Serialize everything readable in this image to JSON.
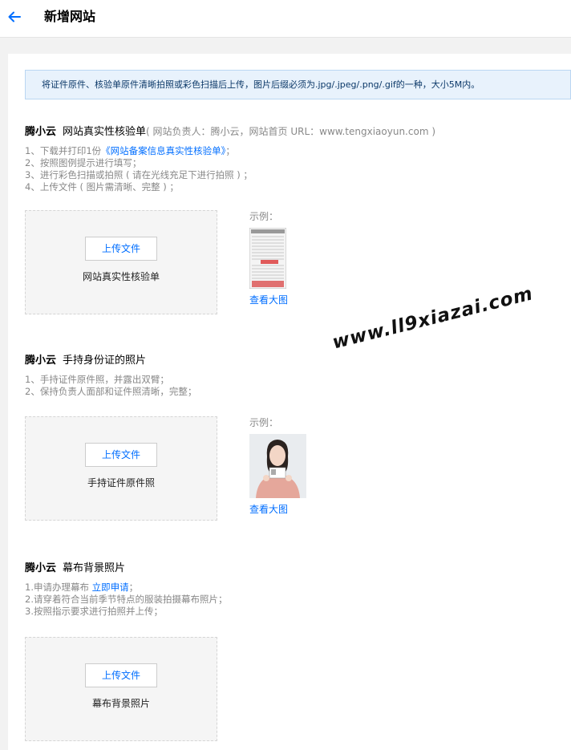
{
  "header": {
    "title": "新增网站",
    "back_icon": "arrow-left-icon"
  },
  "notice": "将证件原件、核验单原件清晰拍照或彩色扫描后上传，图片后缀必须为.jpg/.jpeg/.png/.gif的一种，大小5M内。",
  "sections": [
    {
      "brand": "腾小云",
      "name": "网站真实性核验单",
      "meta": "( 网站负责人：腾小云，网站首页 URL：www.tengxiaoyun.com )",
      "steps": [
        {
          "prefix": "1、下载并打印1份",
          "link": "《网站备案信息真实性核验单》",
          "suffix": "；"
        },
        {
          "prefix": "2、按照图例提示进行填写；"
        },
        {
          "prefix": "3、进行彩色扫描或拍照 ( 请在光线充足下进行拍照 ) ；"
        },
        {
          "prefix": "4、上传文件 ( 图片需清晰、完整 ) ；"
        }
      ],
      "upload_button": "上传文件",
      "upload_label": "网站真实性核验单",
      "example_label": "示例：",
      "view_large": "查看大图"
    },
    {
      "brand": "腾小云",
      "name": "手持身份证的照片",
      "steps": [
        {
          "prefix": "1、手持证件原件照，并露出双臂；"
        },
        {
          "prefix": "2、保持负责人面部和证件照清晰，完整；"
        }
      ],
      "upload_button": "上传文件",
      "upload_label": "手持证件原件照",
      "example_label": "示例：",
      "view_large": "查看大图"
    },
    {
      "brand": "腾小云",
      "name": "幕布背景照片",
      "steps": [
        {
          "prefix": "1.申请办理幕布 ",
          "link": "立即申请",
          "suffix": "；"
        },
        {
          "prefix": "2.请穿着符合当前季节特点的服装拍摄幕布照片；"
        },
        {
          "prefix": "3.按照指示要求进行拍照并上传；"
        }
      ],
      "upload_button": "上传文件",
      "upload_label": "幕布背景照片"
    }
  ],
  "watermark": "www.ll9xiazai.com",
  "colors": {
    "link": "#006eff",
    "notice_bg": "#e8f2fc",
    "notice_border": "#bad6f2"
  }
}
